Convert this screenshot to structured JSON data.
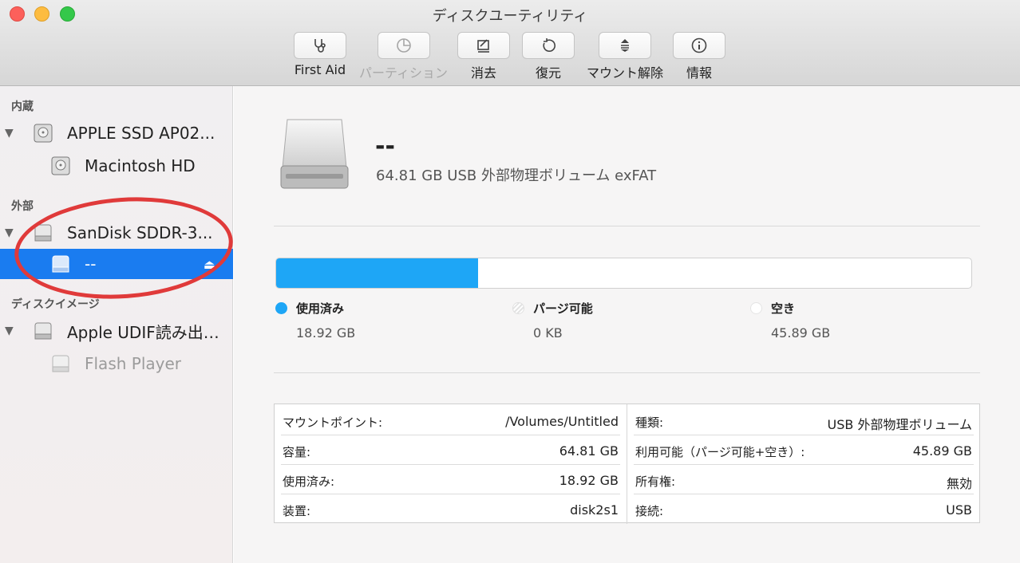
{
  "window": {
    "title": "ディスクユーティリティ"
  },
  "toolbar": {
    "first_aid": "First Aid",
    "partition": "パーティション",
    "erase": "消去",
    "restore": "復元",
    "unmount": "マウント解除",
    "info": "情報"
  },
  "sidebar": {
    "sections": {
      "internal": "内蔵",
      "external": "外部",
      "disk_images": "ディスクイメージ"
    },
    "items": [
      {
        "label": "APPLE SSD AP02..."
      },
      {
        "label": "Macintosh HD"
      },
      {
        "label": "SanDisk SDDR-3..."
      },
      {
        "label": "--"
      },
      {
        "label": "Apple UDIF読み出…"
      },
      {
        "label": "Flash Player"
      }
    ]
  },
  "volume": {
    "title": "--",
    "description": "64.81 GB USB 外部物理ボリューム exFAT"
  },
  "usage": {
    "used_fraction": 0.29,
    "used_color": "#1ea6f6",
    "legend": [
      {
        "label": "使用済み",
        "value": "18.92 GB"
      },
      {
        "label": "パージ可能",
        "value": "0 KB"
      },
      {
        "label": "空き",
        "value": "45.89 GB"
      }
    ]
  },
  "details": {
    "left": [
      {
        "key": "マウントポイント:",
        "value": "/Volumes/Untitled"
      },
      {
        "key": "容量:",
        "value": "64.81 GB"
      },
      {
        "key": "使用済み:",
        "value": "18.92 GB"
      },
      {
        "key": "装置:",
        "value": "disk2s1"
      }
    ],
    "right": [
      {
        "key": "種類:",
        "value": "USB 外部物理ボリューム"
      },
      {
        "key": "利用可能（パージ可能+空き）:",
        "value": "45.89 GB"
      },
      {
        "key": "所有権:",
        "value": "無効"
      },
      {
        "key": "接続:",
        "value": "USB"
      }
    ]
  }
}
